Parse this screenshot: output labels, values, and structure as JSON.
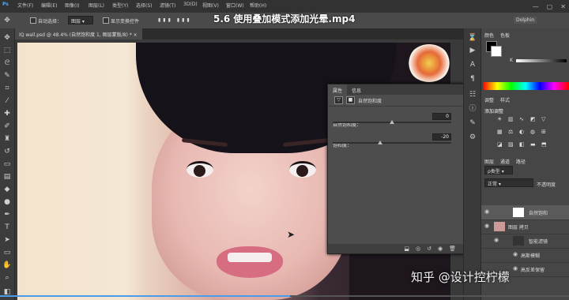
{
  "menubar": {
    "logo": "Ps",
    "items": [
      "文件(F)",
      "编辑(E)",
      "图像(I)",
      "图层(L)",
      "类型(Y)",
      "选择(S)",
      "滤镜(T)",
      "3D(D)",
      "视图(V)",
      "窗口(W)",
      "帮助(H)"
    ],
    "window_controls": [
      "—",
      "▢",
      "✕"
    ]
  },
  "options": {
    "auto_select_label": "自动选择：",
    "auto_select_value": "图层",
    "transform_label": "显示变换控件"
  },
  "video_title": "5.6 使用叠加模式添加光晕.mp4",
  "document": {
    "tab_label": "IQ wall.psd @ 48.4% (自然饱和度 1, 图层蒙版/8) *",
    "close": "×"
  },
  "properties": {
    "tabs": [
      "属性",
      "信息"
    ],
    "header": "自然饱和度",
    "vibrance_label": "自然饱和度：",
    "vibrance_value": "0",
    "vibrance_fraction": 0.5,
    "saturation_label": "饱和度：",
    "saturation_value": "-20",
    "saturation_fraction": 0.4
  },
  "right_panel": {
    "color_tabs": [
      "颜色",
      "色板"
    ],
    "channel_label": "K",
    "adjust_tabs": [
      "调整",
      "样式"
    ],
    "adjust_title": "添加调整",
    "layer_tabs": [
      "图层",
      "通道",
      "路径"
    ],
    "kind_filter": "ρ类型",
    "blend_mode": "正常",
    "opacity_label": "不透明度",
    "layers": [
      "自然饱和",
      "图层 拷贝",
      "智能滤镜",
      "高斯模糊",
      "高反差保留"
    ]
  },
  "dock_icon": "Dolphin",
  "watermark": "知乎 @设计控柠檬",
  "colors": {
    "accent": "#4a9be8",
    "panel_bg": "#4d4d4d"
  },
  "playback": {
    "progress_fraction": 0.51
  }
}
